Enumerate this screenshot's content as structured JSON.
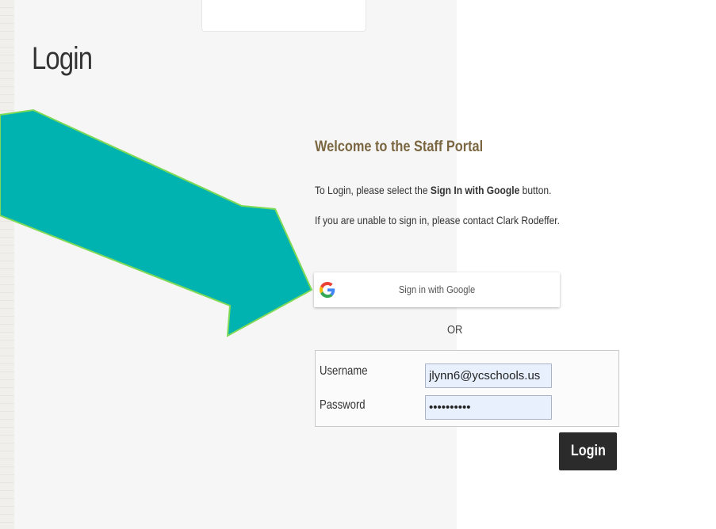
{
  "page": {
    "title": "Login"
  },
  "portal": {
    "heading": "Welcome to the Staff Portal",
    "instruction_prefix": "To Login, please select the ",
    "instruction_bold": "Sign In with Google",
    "instruction_suffix": " button.",
    "help_text": "If you are unable to sign in, please contact Clark Rodeffer.",
    "google_button_label": "Sign in with Google",
    "google_icon": "google-g-icon",
    "or_text": "OR"
  },
  "form": {
    "username_label": "Username",
    "username_value": "jlynn6@ycschools.us",
    "password_label": "Password",
    "password_value": "••••••••••",
    "login_label": "Login"
  },
  "annotation": {
    "arrow_color": "#00b3b0",
    "arrow_border_color": "#7ed957",
    "arrow_shape": "arrow-right-down"
  },
  "colors": {
    "heading": "#7a6640",
    "login_button_bg": "#2b2b2b",
    "input_bg": "#e8f0fe"
  }
}
